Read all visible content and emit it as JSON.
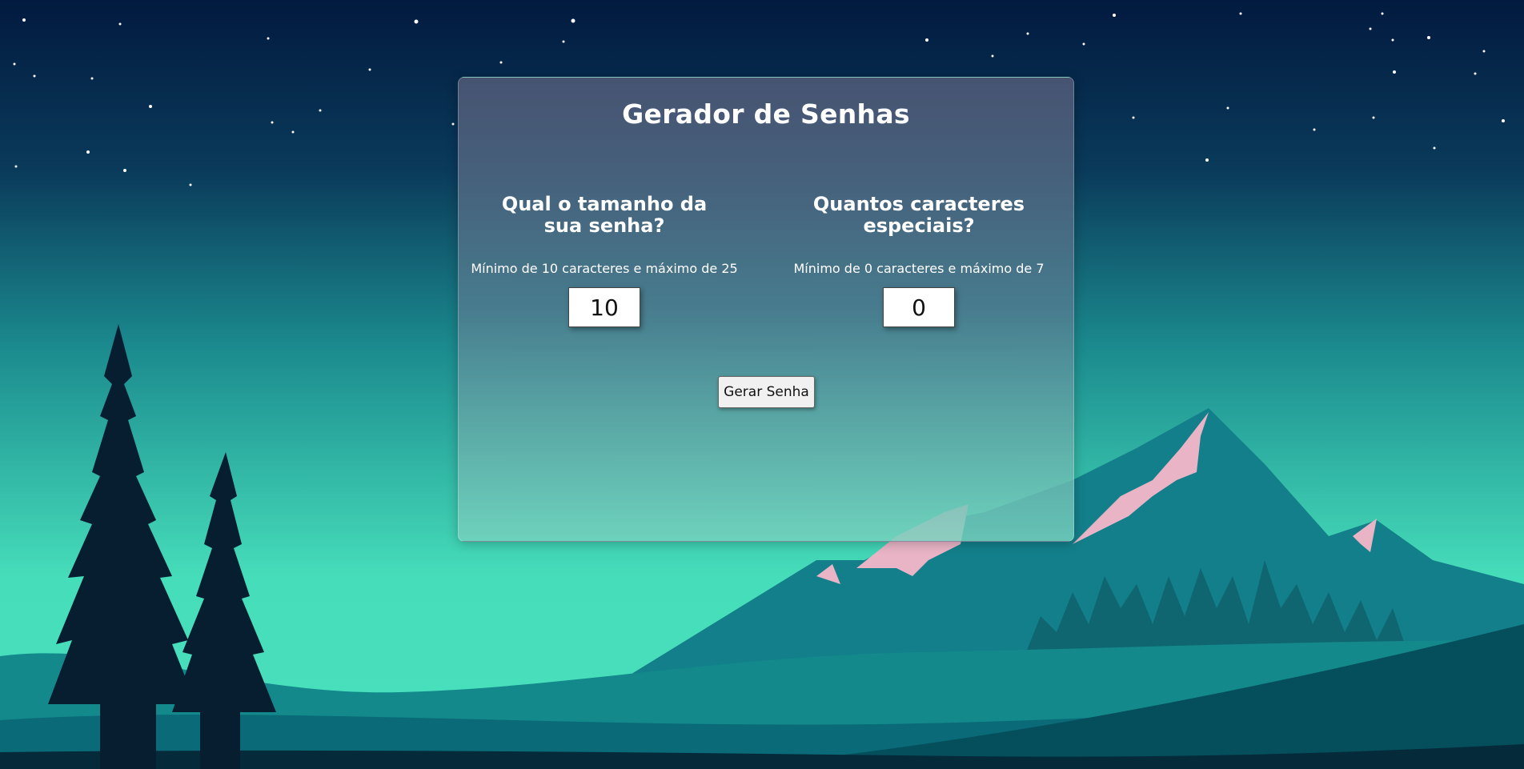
{
  "app": {
    "title": "Gerador de Senhas"
  },
  "length_section": {
    "heading": "Qual o tamanho da sua senha?",
    "hint": "Mínimo de 10 caracteres e máximo de 25",
    "value": "10"
  },
  "special_section": {
    "heading": "Quantos caracteres especiais?",
    "hint": "Mínimo de 0 caracteres e máximo de 7",
    "value": "0"
  },
  "actions": {
    "generate_label": "Gerar Senha"
  },
  "colors": {
    "sky_top": "#021a3f",
    "sky_bottom": "#46ddba",
    "mountain": "#137f8a",
    "snow": "#e8b4c6",
    "trees": "#071e30"
  }
}
